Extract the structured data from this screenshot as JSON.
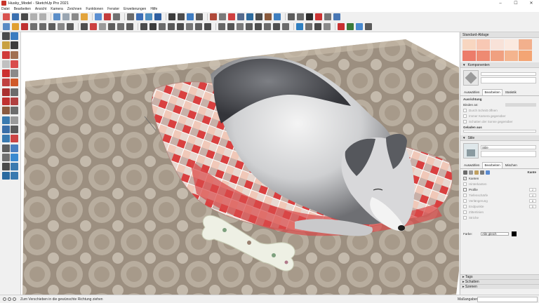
{
  "window": {
    "title": "Husky_Model - SketchUp Pro 2021",
    "controls": [
      "–",
      "☐",
      "✕"
    ]
  },
  "menu": [
    "Datei",
    "Bearbeiten",
    "Ansicht",
    "Kamera",
    "Zeichnen",
    "Funktionen",
    "Fenster",
    "Erweiterungen",
    "Hilfe"
  ],
  "toolbar_colors": {
    "row1": [
      "#d9534f",
      "#3a6fb0",
      "#4a4a4a",
      "#b0b0b0",
      "#b0b0b0",
      "#5c8fc9",
      "#9aa6b2",
      "#8a8a8a",
      "#e3a43c",
      "#5b8fd1",
      "#c43c3c",
      "#707070",
      "#6b6b6b",
      "#3d6fb6",
      "#4f8fc0",
      "#2f5fa0",
      "#3c3c3c",
      "#4d4d4d",
      "#3e7cc1",
      "#5a5a5a",
      "#b04a3a",
      "#7a7a7a",
      "#d04040",
      "#556b8d",
      "#2d6b9e",
      "#4c4c4c",
      "#8a5a3c",
      "#3f7fbf",
      "#5d5d5d",
      "#6a6a6a",
      "#2e2e2e",
      "#cc3333",
      "#777777",
      "#4a78b5"
    ],
    "row2": [
      "#5a8bc4",
      "#e0a030",
      "#c03030",
      "#707070",
      "#6a6a6a",
      "#5d5d5d",
      "#888888",
      "#5a5a5a",
      "#4f4f4f",
      "#cc4040",
      "#9a9a9a",
      "#5e5e5e",
      "#6e6e6e",
      "#5b5b5b",
      "#4c4c4c",
      "#3c3c3c",
      "#6b6b6b",
      "#5a5a5a",
      "#4d4d4d",
      "#777777",
      "#5f5f5f",
      "#4a4a4a",
      "#666666",
      "#555555",
      "#7a7a7a",
      "#5c5c5c",
      "#4e4e4e",
      "#6a6a6a",
      "#505050",
      "#6c6c6c",
      "#2f7fc0",
      "#707070",
      "#4a4a4a",
      "#8a8a8a",
      "#c83030",
      "#3a7a3a",
      "#4a8ad0",
      "#5a5a5a"
    ],
    "left": [
      "#4b4b4b",
      "#3a7cc0",
      "#c8a040",
      "#3c3c3c",
      "#d03a3a",
      "#a07050",
      "#c0c0c0",
      "#d94c4c",
      "#cc3030",
      "#8a8a8a",
      "#c04040",
      "#d05a2a",
      "#aa3030",
      "#6b6b6b",
      "#c03030",
      "#b04040",
      "#8a5a40",
      "#6c6c6c",
      "#3a7ab0",
      "#9a9a9a",
      "#3a6ea8",
      "#5a5a5a",
      "#3a7ab0",
      "#cc4444",
      "#5e5e5e",
      "#4a7fc0",
      "#707070",
      "#3a8ad0",
      "#4a4a4a",
      "#3a7ab0",
      "#2a6aa0",
      "#3a7ab0"
    ]
  },
  "tray": {
    "materials": {
      "title": "Standard-Ablage",
      "swatches": [
        "#f8d6c0",
        "#f8c8b4",
        "#f8e2d8",
        "#fbe9df",
        "#f2b08d",
        "#ec7c6a",
        "#ee8a72",
        "#f0a080",
        "#f4b48e",
        "#f3a574"
      ]
    },
    "components": {
      "title": "Komponenten",
      "tabs": [
        "Auswählen",
        "Bearbeiten",
        "Statistik"
      ],
      "heading": "Ausrichtung",
      "glue_label": "Binden an:",
      "options": [
        "Durch Schnitt öffnen",
        "Immer Kamera gegenüber",
        "Schatten der Sonne gegenüber"
      ],
      "loaded": "Geladen aus"
    },
    "styles": {
      "title": "Stile",
      "style_name": "Stile",
      "tabs": [
        "Auswählen",
        "Bearbeiten",
        "Mischen"
      ],
      "section": "Kante",
      "edges": [
        {
          "label": "Kanten",
          "checked": true,
          "enabled": true,
          "value": ""
        },
        {
          "label": "Hinterkanten",
          "checked": false,
          "enabled": false,
          "value": ""
        },
        {
          "label": "Profile",
          "checked": false,
          "enabled": true,
          "value": "2"
        },
        {
          "label": "Tiefenschärfe",
          "checked": false,
          "enabled": false,
          "value": "4"
        },
        {
          "label": "Verlängerung",
          "checked": false,
          "enabled": false,
          "value": "8"
        },
        {
          "label": "Endpunkte",
          "checked": false,
          "enabled": false,
          "value": "5"
        },
        {
          "label": "Zittertinien",
          "checked": false,
          "enabled": false,
          "value": ""
        },
        {
          "label": "Striche",
          "checked": false,
          "enabled": false,
          "value": ""
        }
      ],
      "color_label": "Farbe:",
      "color_value": "Alle gleich"
    },
    "collapsed": [
      "Tags",
      "Schatten",
      "Szenen"
    ]
  },
  "status": {
    "hint": "Zum Verschieben in die gewünschte Richtung ziehen",
    "measure_label": "Maßangaben"
  }
}
